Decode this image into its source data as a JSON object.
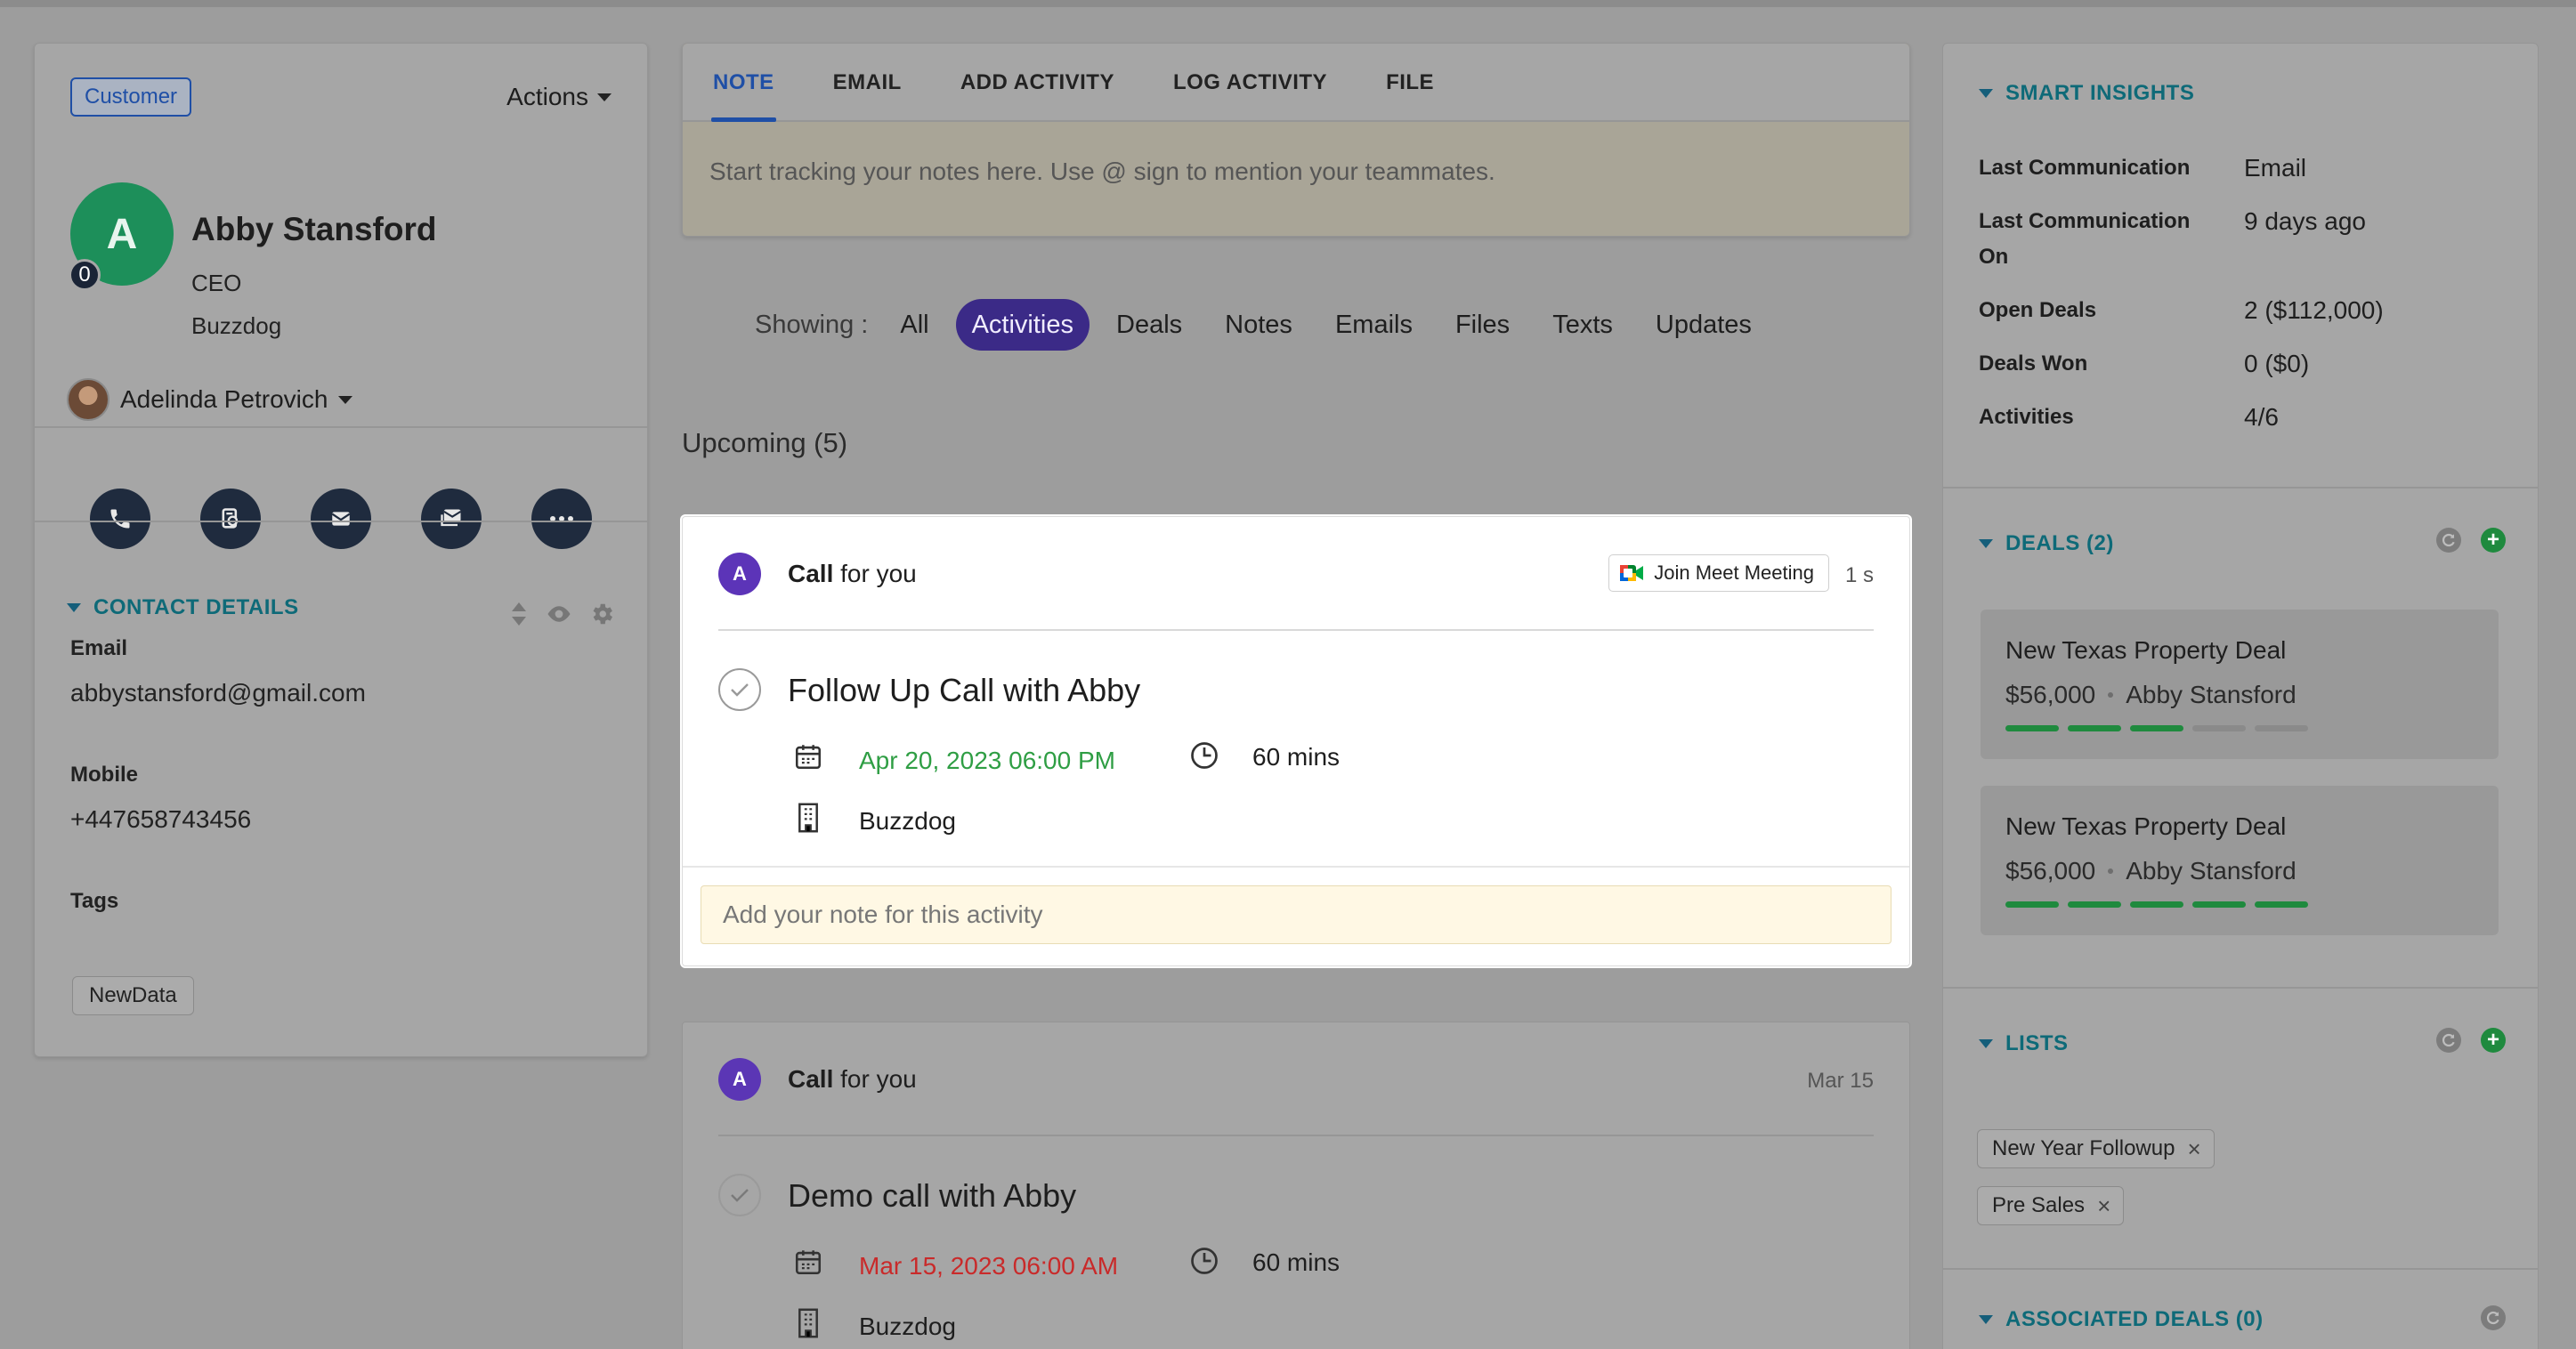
{
  "contact": {
    "badge": "Customer",
    "actions_label": "Actions",
    "avatar_initial": "A",
    "avatar_count": "0",
    "name": "Abby Stansford",
    "role": "CEO",
    "company": "Buzzdog",
    "owner": "Adelinda Petrovich",
    "quick_actions": [
      "phone-icon",
      "call-log-icon",
      "email-icon",
      "bulk-email-icon",
      "more-icon"
    ],
    "details_title": "CONTACT DETAILS",
    "email_label": "Email",
    "email_value": "abbystansford@gmail.com",
    "mobile_label": "Mobile",
    "mobile_value": "+447658743456",
    "tags_label": "Tags",
    "tag": "NewData"
  },
  "composer": {
    "tabs": [
      "NOTE",
      "EMAIL",
      "ADD ACTIVITY",
      "LOG ACTIVITY",
      "FILE"
    ],
    "active_tab": "NOTE",
    "placeholder": "Start tracking your notes here. Use @ sign to mention your teammates."
  },
  "filters": {
    "label": "Showing :",
    "items": [
      "All",
      "Activities",
      "Deals",
      "Notes",
      "Emails",
      "Files",
      "Texts",
      "Updates"
    ],
    "active": "Activities"
  },
  "upcoming_label": "Upcoming (5)",
  "activities": [
    {
      "avatar": "A",
      "type_bold": "Call",
      "type_rest": " for you",
      "join_label": "Join Meet Meeting",
      "time_ago": "1 s",
      "title": "Follow Up Call with Abby",
      "date": "Apr 20, 2023 06:00 PM",
      "duration": "60 mins",
      "company": "Buzzdog",
      "note_placeholder": "Add your note for this activity"
    },
    {
      "avatar": "A",
      "type_bold": "Call",
      "type_rest": " for you",
      "time_ago": "Mar 15",
      "title": "Demo call with Abby",
      "date": "Mar 15, 2023 06:00 AM",
      "duration": "60 mins",
      "company": "Buzzdog"
    }
  ],
  "insights": {
    "title": "SMART INSIGHTS",
    "rows": [
      {
        "label": "Last Communication",
        "value": "Email"
      },
      {
        "label": "Last Communication On",
        "value": "9 days ago"
      },
      {
        "label": "Open Deals",
        "value": "2 ($112,000)"
      },
      {
        "label": "Deals Won",
        "value": "0 ($0)"
      },
      {
        "label": "Activities",
        "value": "4/6"
      }
    ]
  },
  "deals": {
    "title": "DEALS (2)",
    "items": [
      {
        "name": "New Texas Property Deal",
        "amount": "$56,000",
        "contact": "Abby Stansford",
        "stage": 3,
        "stages": 5
      },
      {
        "name": "New Texas Property Deal",
        "amount": "$56,000",
        "contact": "Abby Stansford",
        "stage": 5,
        "stages": 5
      }
    ]
  },
  "lists": {
    "title": "LISTS",
    "items": [
      "New Year Followup",
      "Pre Sales"
    ]
  },
  "associated_deals": {
    "title": "ASSOCIATED DEALS (0)"
  },
  "colors": {
    "accent_blue": "#1f4fa6",
    "teal_heading": "#0e6a78",
    "active_pill": "#3b2a87",
    "success_green": "#2f9e44",
    "overdue_red": "#c92a2a"
  }
}
